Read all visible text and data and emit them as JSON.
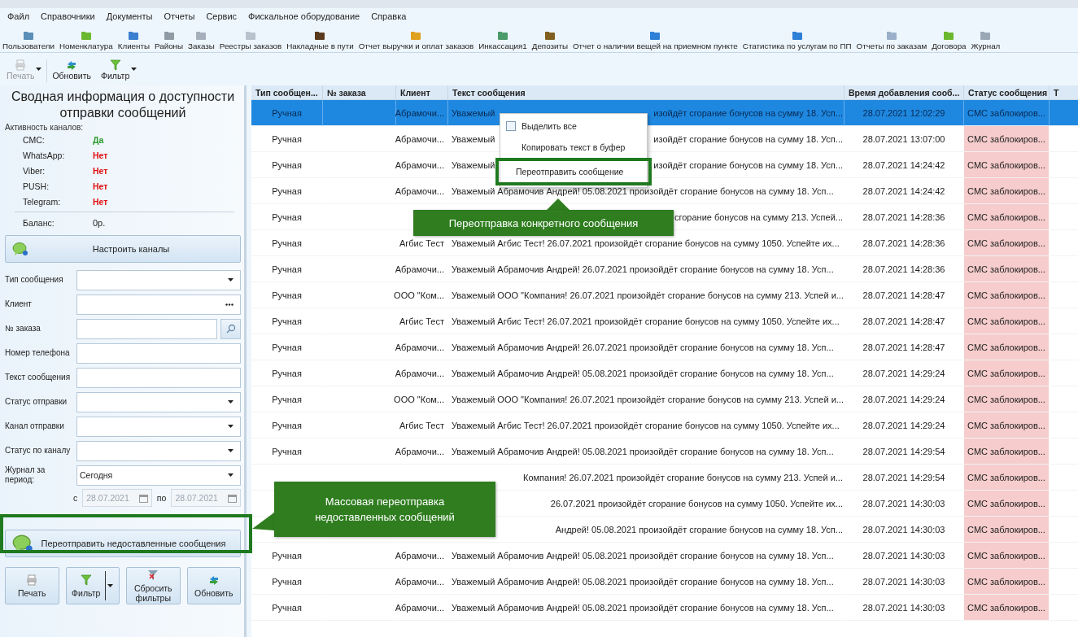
{
  "menu": [
    "Файл",
    "Справочники",
    "Документы",
    "Отчеты",
    "Сервис",
    "Фискальное оборудование",
    "Справка"
  ],
  "toolbar": [
    "Пользователи",
    "Номенклатура",
    "Клиенты",
    "Районы",
    "Заказы",
    "Реестры заказов",
    "Накладные в пути",
    "Отчет выручки и оплат заказов",
    "Инкассация1",
    "Депозиты",
    "Отчет о наличии вещей на приемном пункте",
    "Статистика по услугам по ПП",
    "Отчеты по заказам",
    "Договора",
    "Журнал"
  ],
  "actions": [
    {
      "label": "Печать",
      "kind": "print",
      "dropdown": true,
      "disabled": true
    },
    {
      "label": "Обновить",
      "kind": "refresh",
      "dropdown": false,
      "disabled": false
    },
    {
      "label": "Фильтр",
      "kind": "filter",
      "dropdown": true,
      "disabled": false
    }
  ],
  "summary": {
    "title": "Сводная информация о доступности отправки сообщений",
    "channels_label": "Активность каналов:",
    "channels": [
      {
        "name": "СМС:",
        "value": "Да",
        "active": true
      },
      {
        "name": "WhatsApp:",
        "value": "Нет",
        "active": false
      },
      {
        "name": "Viber:",
        "value": "Нет",
        "active": false
      },
      {
        "name": "PUSH:",
        "value": "Нет",
        "active": false
      },
      {
        "name": "Telegram:",
        "value": "Нет",
        "active": false
      }
    ],
    "balance": {
      "label": "Баланс:",
      "value": "0р."
    },
    "configure_button": "Настроить каналы"
  },
  "filters": [
    {
      "label": "Тип сообщения",
      "kind": "select"
    },
    {
      "label": "Клиент",
      "kind": "lookup"
    },
    {
      "label": "№ заказа",
      "kind": "search"
    },
    {
      "label": "Номер телефона",
      "kind": "text"
    },
    {
      "label": "Текст сообщения",
      "kind": "text"
    },
    {
      "label": "Статус отправки",
      "kind": "select"
    },
    {
      "label": "Канал отправки",
      "kind": "select"
    },
    {
      "label": "Статус по каналу",
      "kind": "select"
    },
    {
      "label": "Журнал за период:",
      "kind": "select",
      "value": "Сегодня"
    }
  ],
  "period": {
    "from_label": "с",
    "from": "28.07.2021",
    "to_label": "по",
    "to": "28.07.2021",
    "disabled": true
  },
  "resend_button": "Переотправить недоставленные сообщения",
  "bottom_buttons": [
    {
      "label": "Печать",
      "kind": "print",
      "dropdown": false
    },
    {
      "label": "Фильтр",
      "kind": "filter",
      "dropdown": true
    },
    {
      "label": "Сбросить фильтры",
      "kind": "reset",
      "dropdown": false
    },
    {
      "label": "Обновить",
      "kind": "refresh",
      "dropdown": false
    }
  ],
  "table": {
    "columns": [
      "Тип сообщен...",
      "№ заказа",
      "Клиент",
      "Текст сообщения",
      "Время добавления сооб...",
      "Статус сообщения",
      "Т"
    ],
    "rows": [
      {
        "type": "Ручная",
        "client": "Абрамочи...",
        "text": "Уважемый",
        "text_tail": "изойдёт сгорание бонусов на сумму 18. Усп...",
        "time": "28.07.2021 12:02:29",
        "status": "СМС заблокиров...",
        "selected": true
      },
      {
        "type": "Ручная",
        "client": "Абрамочи...",
        "text": "Уважемый",
        "text_tail": "изойдёт сгорание бонусов на сумму 18. Усп...",
        "time": "28.07.2021 13:07:00",
        "status": "СМС заблокиров...",
        "selected": false
      },
      {
        "type": "Ручная",
        "client": "Абрамочи...",
        "text": "Уважемый",
        "text_tail": "изойдёт сгорание бонусов на сумму 18. Усп...",
        "time": "28.07.2021 14:24:42",
        "status": "СМС заблокиров...",
        "selected": false
      },
      {
        "type": "Ручная",
        "client": "Абрамочи...",
        "text": "Уважемый Абрамочив Андрей! 05.08.2021 произойдёт сгорание бонусов на сумму 18. Усп...",
        "time": "28.07.2021 14:24:42",
        "status": "СМС заблокиров...",
        "selected": false
      },
      {
        "type": "Ручная",
        "text_tail": "сгорание бонусов на сумму 213. Успей...",
        "time": "28.07.2021 14:28:36",
        "status": "СМС заблокиров...",
        "selected": false
      },
      {
        "type": "Ручная",
        "client": "Агбис Тест",
        "text": "Уважемый Агбис Тест! 26.07.2021 произойдёт сгорание бонусов на сумму 1050. Успейте их...",
        "time": "28.07.2021 14:28:36",
        "status": "СМС заблокиров...",
        "selected": false
      },
      {
        "type": "Ручная",
        "client": "Абрамочи...",
        "text": "Уважемый Абрамочив Андрей! 26.07.2021 произойдёт сгорание бонусов на сумму 18. Усп...",
        "time": "28.07.2021 14:28:36",
        "status": "СМС заблокиров...",
        "selected": false
      },
      {
        "type": "Ручная",
        "client": "ООО \"Ком...",
        "text": "Уважемый ООО \"Компания! 26.07.2021 произойдёт сгорание бонусов на сумму 213. Успей и...",
        "time": "28.07.2021 14:28:47",
        "status": "СМС заблокиров...",
        "selected": false
      },
      {
        "type": "Ручная",
        "client": "Агбис Тест",
        "text": "Уважемый Агбис Тест! 26.07.2021 произойдёт сгорание бонусов на сумму 1050. Успейте их...",
        "time": "28.07.2021 14:28:47",
        "status": "СМС заблокиров...",
        "selected": false
      },
      {
        "type": "Ручная",
        "client": "Абрамочи...",
        "text": "Уважемый Абрамочив Андрей! 26.07.2021 произойдёт сгорание бонусов на сумму 18. Усп...",
        "time": "28.07.2021 14:28:47",
        "status": "СМС заблокиров...",
        "selected": false
      },
      {
        "type": "Ручная",
        "client": "Абрамочи...",
        "text": "Уважемый Абрамочив Андрей! 05.08.2021 произойдёт сгорание бонусов на сумму 18. Усп...",
        "time": "28.07.2021 14:29:24",
        "status": "СМС заблокиров...",
        "selected": false
      },
      {
        "type": "Ручная",
        "client": "ООО \"Ком...",
        "text": "Уважемый ООО \"Компания! 26.07.2021 произойдёт сгорание бонусов на сумму 213. Успей и...",
        "time": "28.07.2021 14:29:24",
        "status": "СМС заблокиров...",
        "selected": false
      },
      {
        "type": "Ручная",
        "client": "Агбис Тест",
        "text": "Уважемый Агбис Тест! 26.07.2021 произойдёт сгорание бонусов на сумму 1050. Успейте их...",
        "time": "28.07.2021 14:29:24",
        "status": "СМС заблокиров...",
        "selected": false
      },
      {
        "type": "Ручная",
        "client": "Абрамочи...",
        "text": "Уважемый Абрамочив Андрей! 05.08.2021 произойдёт сгорание бонусов на сумму 18. Усп...",
        "time": "28.07.2021 14:29:54",
        "status": "СМС заблокиров...",
        "selected": false
      },
      {
        "text_tail": "Компания! 26.07.2021 произойдёт сгорание бонусов на сумму 213. Успей и...",
        "time": "28.07.2021 14:29:54",
        "status": "СМС заблокиров...",
        "selected": false
      },
      {
        "text_tail": "26.07.2021 произойдёт сгорание бонусов на сумму 1050. Успейте их...",
        "time": "28.07.2021 14:30:03",
        "status": "СМС заблокиров...",
        "selected": false
      },
      {
        "text_tail": "Андрей! 05.08.2021 произойдёт сгорание бонусов на сумму 18. Усп...",
        "time": "28.07.2021 14:30:03",
        "status": "СМС заблокиров...",
        "selected": false
      },
      {
        "type": "Ручная",
        "client": "Абрамочи...",
        "text": "Уважемый Абрамочив Андрей! 05.08.2021 произойдёт сгорание бонусов на сумму 18. Усп...",
        "time": "28.07.2021 14:30:03",
        "status": "СМС заблокиров...",
        "selected": false
      },
      {
        "type": "Ручная",
        "client": "Абрамочи...",
        "text": "Уважемый Абрамочив Андрей! 05.08.2021 произойдёт сгорание бонусов на сумму 18. Усп...",
        "time": "28.07.2021 14:30:03",
        "status": "СМС заблокиров...",
        "selected": false
      },
      {
        "type": "Ручная",
        "client": "Абрамочи...",
        "text": "Уважемый Абрамочив Андрей! 05.08.2021 произойдёт сгорание бонусов на сумму 18. Усп...",
        "time": "28.07.2021 14:30:03",
        "status": "СМС заблокиров...",
        "selected": false
      }
    ]
  },
  "context_menu": {
    "items": [
      {
        "label": "Выделить все",
        "kind": "check",
        "highlighted": false
      },
      {
        "label": "Копировать текст в буфер",
        "kind": "plain",
        "highlighted": false
      },
      {
        "label": "Переотправить сообщение",
        "kind": "plain",
        "highlighted": true
      }
    ]
  },
  "callouts": [
    {
      "text": "Переотправка конкретного сообщения",
      "kind": "row"
    },
    {
      "text": "Массовая переотправка недоставленных сообщений",
      "kind": "bulk"
    }
  ]
}
